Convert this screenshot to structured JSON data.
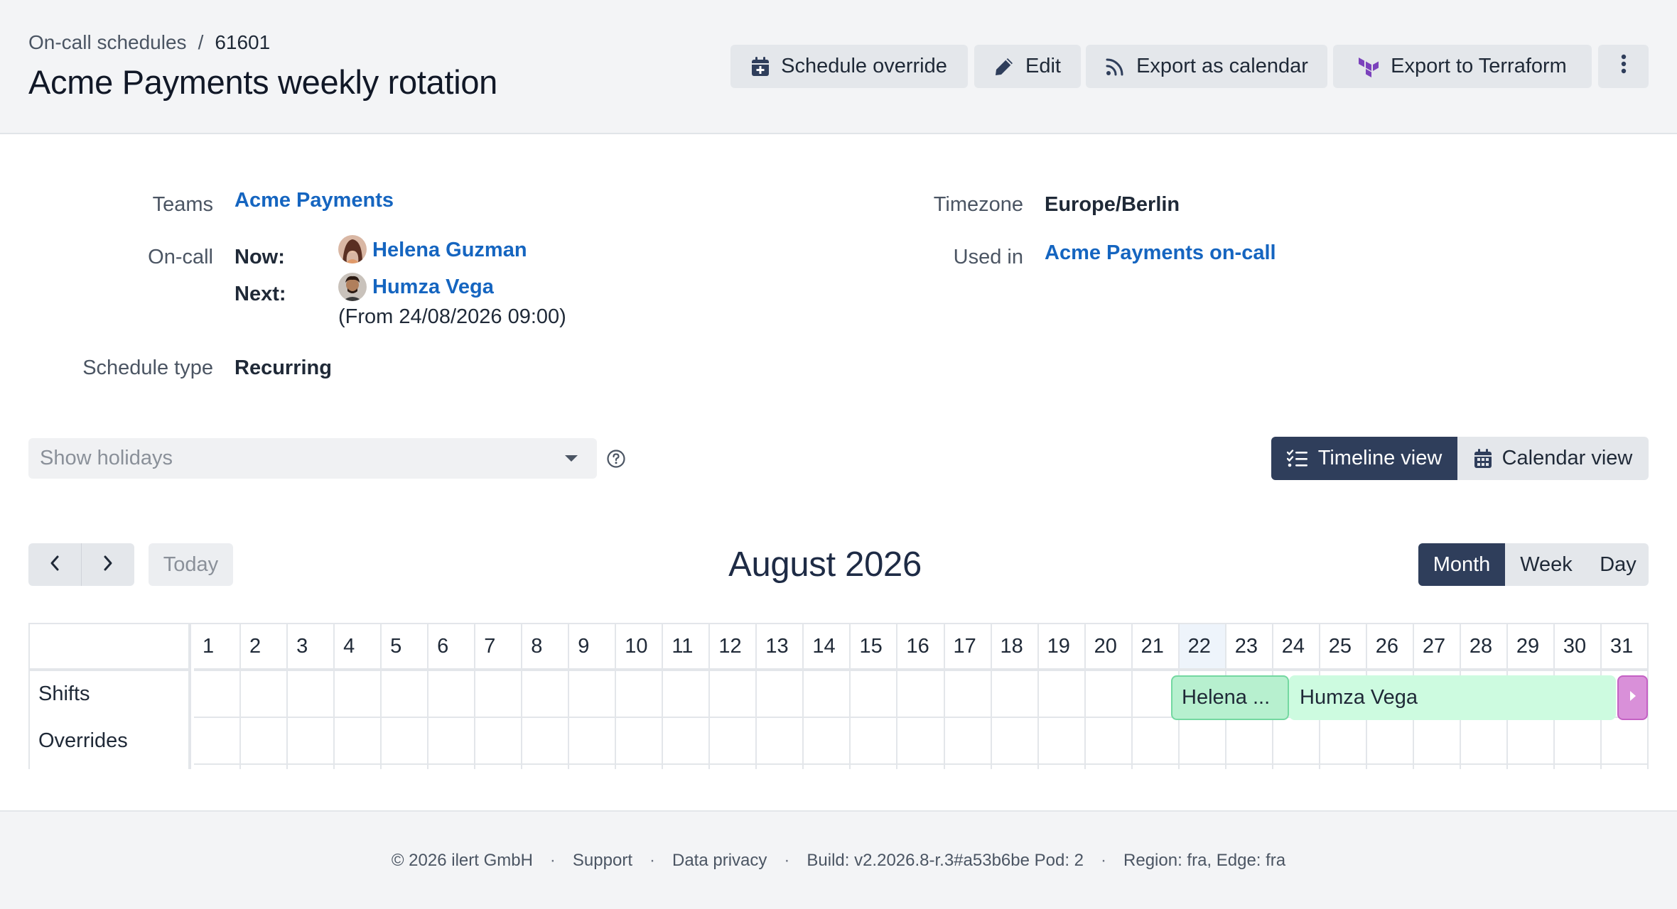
{
  "header": {
    "breadcrumb_parent": "On-call schedules",
    "breadcrumb_separator": "/",
    "breadcrumb_current": "61601",
    "title": "Acme Payments weekly rotation",
    "buttons": {
      "schedule_override": "Schedule override",
      "edit": "Edit",
      "export_calendar": "Export as calendar",
      "export_terraform": "Export to Terraform"
    },
    "icons": [
      "calendar-plus-icon",
      "pencil-icon",
      "rss-icon",
      "terraform-icon",
      "kebab-menu-icon"
    ]
  },
  "info": {
    "teams_label": "Teams",
    "teams_value": "Acme Payments",
    "oncall_label": "On-call",
    "now_label": "Now:",
    "now_user": "Helena Guzman",
    "next_label": "Next:",
    "next_user": "Humza Vega",
    "next_from": "(From 24/08/2026 09:00)",
    "schedule_type_label": "Schedule type",
    "schedule_type_value": "Recurring",
    "timezone_label": "Timezone",
    "timezone_value": "Europe/Berlin",
    "used_in_label": "Used in",
    "used_in_value": "Acme Payments on-call"
  },
  "holidays": {
    "placeholder": "Show holidays"
  },
  "view_toggle": {
    "timeline": "Timeline view",
    "calendar": "Calendar view",
    "active": "timeline"
  },
  "calendar_nav": {
    "today": "Today",
    "month_title": "August 2026",
    "ranges": {
      "month": "Month",
      "week": "Week",
      "day": "Day"
    },
    "active_range": "month"
  },
  "timeline": {
    "rows": [
      "Shifts",
      "Overrides"
    ],
    "days": [
      "1",
      "2",
      "3",
      "4",
      "5",
      "6",
      "7",
      "8",
      "9",
      "10",
      "11",
      "12",
      "13",
      "14",
      "15",
      "16",
      "17",
      "18",
      "19",
      "20",
      "21",
      "22",
      "23",
      "24",
      "25",
      "26",
      "27",
      "28",
      "29",
      "30",
      "31"
    ],
    "today_day": "22",
    "shifts": [
      {
        "label": "Helena ...",
        "person": "Helena Guzman",
        "color": "#b7f0cf"
      },
      {
        "label": "Humza Vega",
        "person": "Humza Vega",
        "color": "#cdfbe0"
      }
    ],
    "more_indicator_color": "#d990d9"
  },
  "footer": {
    "copyright": "© 2026 ilert GmbH",
    "support": "Support",
    "privacy": "Data privacy",
    "build": "Build: v2.2026.8-r.3#a53b6be Pod: 2",
    "region": "Region: fra, Edge: fra",
    "separator": "·"
  },
  "colors": {
    "link": "#1565c0",
    "primary_dark": "#2f3e5b",
    "header_bg": "#f3f4f6",
    "button_bg": "#e4e7eb",
    "terraform_purple": "#7b42bc"
  }
}
